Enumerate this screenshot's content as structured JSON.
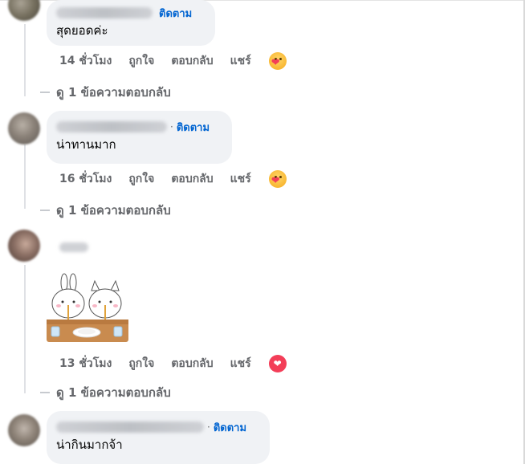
{
  "comments": [
    {
      "follow_label": "ติดตาม",
      "text": "สุดยอดค่ะ",
      "time": "14 ชั่วโมง",
      "like": "ถูกใจ",
      "reply": "ตอบกลับ",
      "share": "แชร์",
      "reaction_icon": "care-reaction-icon",
      "replies_label": "ดู 1 ข้อความตอบกลับ"
    },
    {
      "separator": "·",
      "follow_label": "ติดตาม",
      "text": "น่าทานมาก",
      "time": "16 ชั่วโมง",
      "like": "ถูกใจ",
      "reply": "ตอบกลับ",
      "share": "แชร์",
      "reaction_icon": "care-reaction-icon",
      "replies_label": "ดู 1 ข้อความตอบกลับ"
    },
    {
      "sticker_icon": "bunny-cat-dinner-sticker-icon",
      "time": "13 ชั่วโมง",
      "like": "ถูกใจ",
      "reply": "ตอบกลับ",
      "share": "แชร์",
      "reaction_icon": "love-reaction-icon",
      "replies_label": "ดู 1 ข้อความตอบกลับ"
    },
    {
      "separator": "·",
      "follow_label": "ติดตาม",
      "text": "น่ากินมากจ้า"
    }
  ],
  "colors": {
    "bubble": "#f0f2f5",
    "follow": "#0064d1",
    "meta": "#65676b",
    "love": "#f33e58"
  }
}
